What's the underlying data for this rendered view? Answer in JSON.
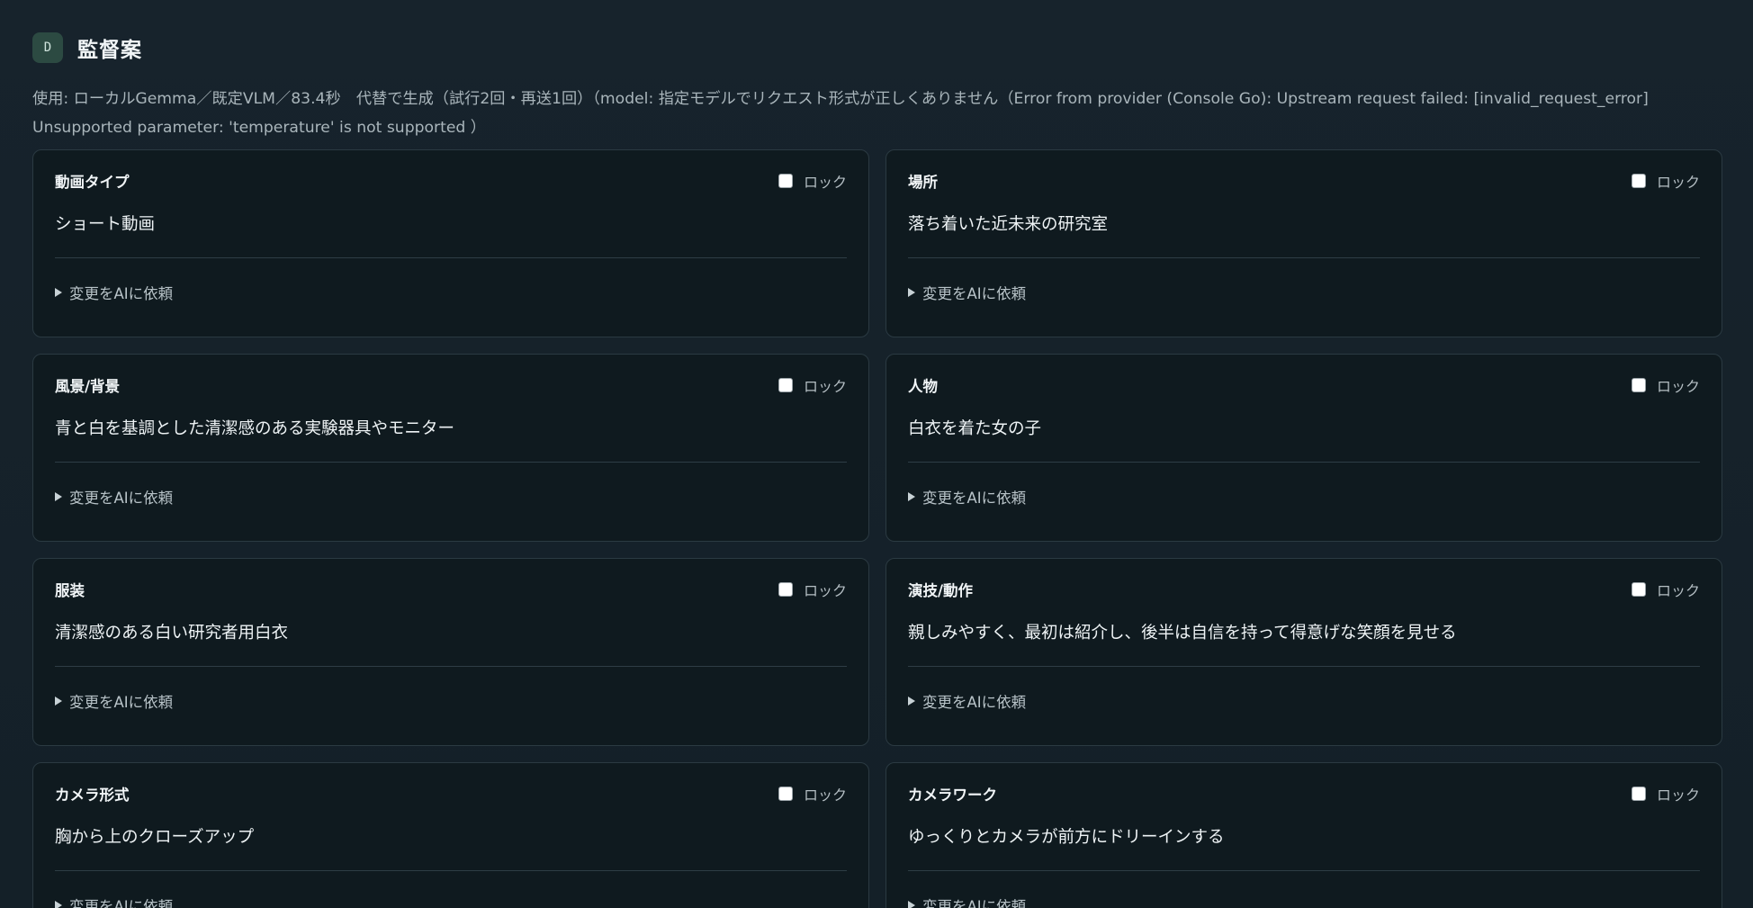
{
  "header": {
    "badge": "D",
    "title": "監督案"
  },
  "usage_text": "使用: ローカルGemma／既定VLM／83.4秒　代替で生成（試行2回・再送1回）（model: 指定モデルでリクエスト形式が正しくありません（Error from provider (Console Go): Upstream request failed: [invalid_request_error] Unsupported parameter: 'temperature' is not supported ）",
  "cards": [
    {
      "label": "動画タイプ",
      "value": "ショート動画",
      "lock_label": "ロック",
      "locked": false,
      "ai_request_label": "変更をAIに依頼"
    },
    {
      "label": "場所",
      "value": "落ち着いた近未来の研究室",
      "lock_label": "ロック",
      "locked": false,
      "ai_request_label": "変更をAIに依頼"
    },
    {
      "label": "風景/背景",
      "value": "青と白を基調とした清潔感のある実験器具やモニター",
      "lock_label": "ロック",
      "locked": false,
      "ai_request_label": "変更をAIに依頼"
    },
    {
      "label": "人物",
      "value": "白衣を着た女の子",
      "lock_label": "ロック",
      "locked": false,
      "ai_request_label": "変更をAIに依頼"
    },
    {
      "label": "服装",
      "value": "清潔感のある白い研究者用白衣",
      "lock_label": "ロック",
      "locked": false,
      "ai_request_label": "変更をAIに依頼"
    },
    {
      "label": "演技/動作",
      "value": "親しみやすく、最初は紹介し、後半は自信を持って得意げな笑顔を見せる",
      "lock_label": "ロック",
      "locked": false,
      "ai_request_label": "変更をAIに依頼"
    },
    {
      "label": "カメラ形式",
      "value": "胸から上のクローズアップ",
      "lock_label": "ロック",
      "locked": false,
      "ai_request_label": "変更をAIに依頼"
    },
    {
      "label": "カメラワーク",
      "value": "ゆっくりとカメラが前方にドリーインする",
      "lock_label": "ロック",
      "locked": false,
      "ai_request_label": "変更をAIに依頼"
    }
  ]
}
